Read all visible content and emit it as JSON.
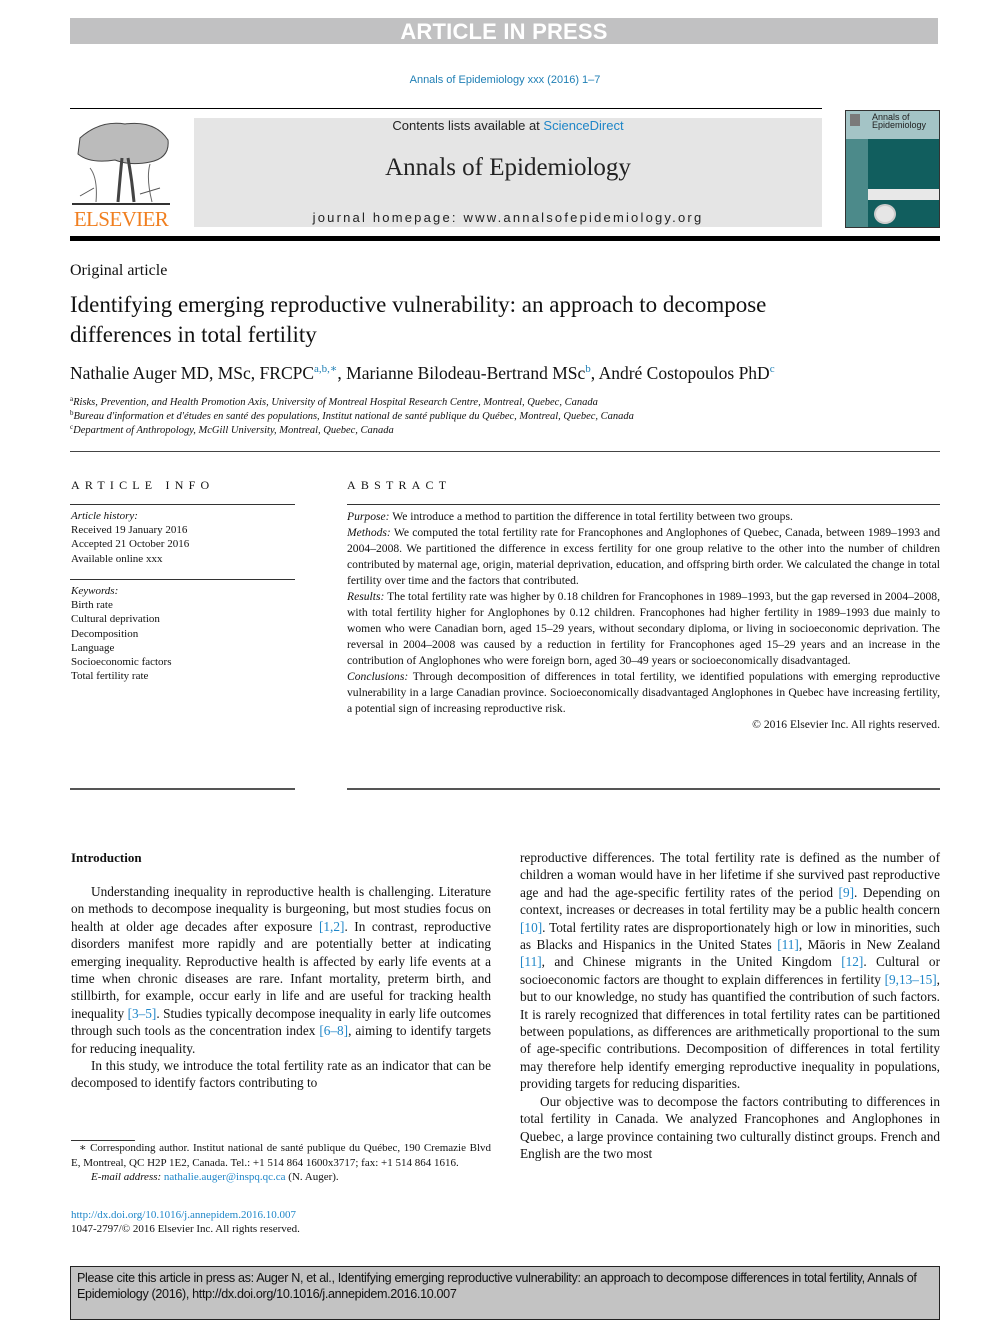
{
  "banner": "ARTICLE IN PRESS",
  "journal_ref": "Annals of Epidemiology xxx (2016) 1–7",
  "masthead": {
    "contents_prefix": "Contents lists available at ",
    "contents_link": "ScienceDirect",
    "journal_title": "Annals of Epidemiology",
    "homepage": "journal homepage: www.annalsofepidemiology.org",
    "publisher_logo_text": "ELSEVIER",
    "cover_title": "Annals of Epidemiology"
  },
  "colors": {
    "link": "#1f86c8",
    "elsevier_orange": "#f07f20",
    "cover_teal": "#115e5e",
    "banner_gray": "#c1c1c2"
  },
  "article": {
    "type": "Original article",
    "title": "Identifying emerging reproductive vulnerability: an approach to decompose differences in total fertility",
    "authors": [
      {
        "name": "Nathalie Auger MD, MSc, FRCPC",
        "sup": "a,b,∗",
        "sep": ", "
      },
      {
        "name": "Marianne Bilodeau-Bertrand MSc",
        "sup": "b",
        "sep": ", "
      },
      {
        "name": "André Costopoulos PhD",
        "sup": "c",
        "sep": ""
      }
    ],
    "affiliations": [
      {
        "mark": "a",
        "text": "Risks, Prevention, and Health Promotion Axis, University of Montreal Hospital Research Centre, Montreal, Quebec, Canada"
      },
      {
        "mark": "b",
        "text": "Bureau d'information et d'études en santé des populations, Institut national de santé publique du Québec, Montreal, Quebec, Canada"
      },
      {
        "mark": "c",
        "text": "Department of Anthropology, McGill University, Montreal, Quebec, Canada"
      }
    ]
  },
  "article_info": {
    "label": "ARTICLE INFO",
    "history_heading": "Article history:",
    "history": [
      "Received 19 January 2016",
      "Accepted 21 October 2016",
      "Available online xxx"
    ],
    "keywords_heading": "Keywords:",
    "keywords": [
      "Birth rate",
      "Cultural deprivation",
      "Decomposition",
      "Language",
      "Socioeconomic factors",
      "Total fertility rate"
    ]
  },
  "abstract": {
    "label": "ABSTRACT",
    "sections": [
      {
        "label": "Purpose:",
        "text": " We introduce a method to partition the difference in total fertility between two groups."
      },
      {
        "label": "Methods:",
        "text": " We computed the total fertility rate for Francophones and Anglophones of Quebec, Canada, between 1989–1993 and 2004–2008. We partitioned the difference in excess fertility for one group relative to the other into the number of children contributed by maternal age, origin, material deprivation, education, and offspring birth order. We calculated the change in total fertility over time and the factors that contributed."
      },
      {
        "label": "Results:",
        "text": " The total fertility rate was higher by 0.18 children for Francophones in 1989–1993, but the gap reversed in 2004–2008, with total fertility higher for Anglophones by 0.12 children. Francophones had higher fertility in 1989–1993 due mainly to women who were Canadian born, aged 15–29 years, without secondary diploma, or living in socioeconomic deprivation. The reversal in 2004–2008 was caused by a reduction in fertility for Francophones aged 15–29 years and an increase in the contribution of Anglophones who were foreign born, aged 30–49 years or socioeconomically disadvantaged."
      },
      {
        "label": "Conclusions:",
        "text": " Through decomposition of differences in total fertility, we identified populations with emerging reproductive vulnerability in a large Canadian province. Socioeconomically disadvantaged Anglophones in Quebec have increasing fertility, a potential sign of increasing reproductive risk."
      }
    ],
    "copyright": "© 2016 Elsevier Inc. All rights reserved."
  },
  "introduction": {
    "heading": "Introduction",
    "left_paragraphs": [
      [
        {
          "t": "Understanding inequality in reproductive health is challenging. Literature on methods to decompose inequality is burgeoning, but most studies focus on health at older age decades after exposure "
        },
        {
          "r": "[1,2]"
        },
        {
          "t": ". In contrast, reproductive disorders manifest more rapidly and are potentially better at indicating emerging inequality. Reproductive health is affected by early life events at a time when chronic diseases are rare. Infant mortality, preterm birth, and stillbirth, for example, occur early in life and are useful for tracking health inequality "
        },
        {
          "r": "[3–5]"
        },
        {
          "t": ". Studies typically decompose inequality in early life outcomes through such tools as the concentration index "
        },
        {
          "r": "[6–8]"
        },
        {
          "t": ", aiming to identify targets for reducing inequality."
        }
      ],
      [
        {
          "t": "In this study, we introduce the total fertility rate as an indicator that can be decomposed to identify factors contributing to"
        }
      ]
    ],
    "right_paragraphs": [
      [
        {
          "t": "reproductive differences. The total fertility rate is defined as the number of children a woman would have in her lifetime if she survived past reproductive age and had the age-specific fertility rates of the period "
        },
        {
          "r": "[9]"
        },
        {
          "t": ". Depending on context, increases or decreases in total fertility may be a public health concern "
        },
        {
          "r": "[10]"
        },
        {
          "t": ". Total fertility rates are disproportionately high or low in minorities, such as Blacks and Hispanics in the United States "
        },
        {
          "r": "[11]"
        },
        {
          "t": ", Māoris in New Zealand "
        },
        {
          "r": "[11]"
        },
        {
          "t": ", and Chinese migrants in the United Kingdom "
        },
        {
          "r": "[12]"
        },
        {
          "t": ". Cultural or socioeconomic factors are thought to explain differences in fertility "
        },
        {
          "r": "[9,13–15]"
        },
        {
          "t": ", but to our knowledge, no study has quantified the contribution of such factors. It is rarely recognized that differences in total fertility rates can be partitioned between populations, as differences are arithmetically proportional to the sum of age-specific contributions. Decomposition of differences in total fertility may therefore help identify emerging reproductive inequality in populations, providing targets for reducing disparities."
        }
      ],
      [
        {
          "t": "Our objective was to decompose the factors contributing to differences in total fertility in Canada. We analyzed Francophones and Anglophones in Quebec, a large province containing two culturally distinct groups. French and English are the two most"
        }
      ]
    ]
  },
  "footnote": {
    "corresponding": "∗ Corresponding author. Institut national de santé publique du Québec, 190 Cremazie Blvd E, Montreal, QC H2P 1E2, Canada. Tel.: +1 514 864 1600x3717; fax: +1 514 864 1616.",
    "email_label": "E-mail address:",
    "email": "nathalie.auger@inspq.qc.ca",
    "email_suffix": " (N. Auger).",
    "doi": "http://dx.doi.org/10.1016/j.annepidem.2016.10.007",
    "issn": "1047-2797/© 2016 Elsevier Inc. All rights reserved."
  },
  "cite_box": "Please cite this article in press as: Auger N, et al., Identifying emerging reproductive vulnerability: an approach to decompose differences in total fertility, Annals of Epidemiology (2016), http://dx.doi.org/10.1016/j.annepidem.2016.10.007"
}
